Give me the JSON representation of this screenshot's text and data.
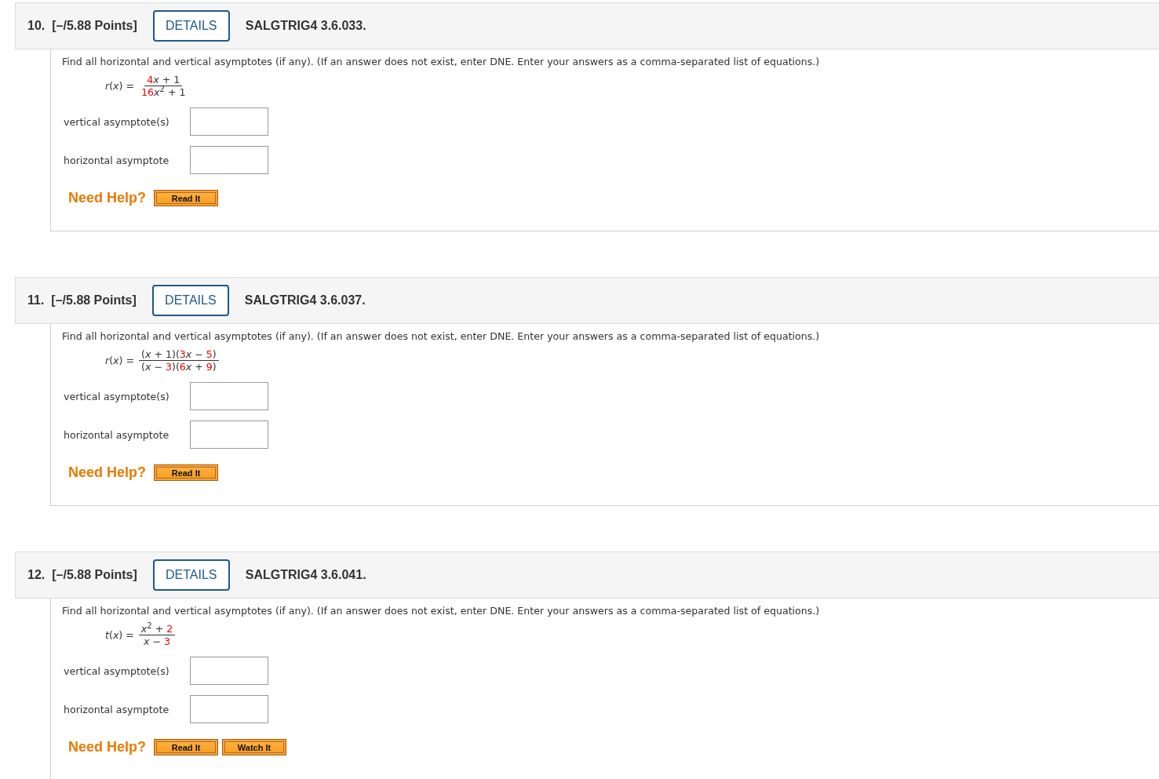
{
  "questions": [
    {
      "number": "10.",
      "points": "[–/5.88 Points]",
      "details_label": "DETAILS",
      "code": "SALGTRIG4 3.6.033.",
      "prompt": "Find all horizontal and vertical asymptotes (if any). (If an answer does not exist, enter DNE. Enter your answers as a comma-separated list of equations.)",
      "function_name": "*r*(*x*) =",
      "numerator": [
        {
          "text": "4",
          "highlighted": true
        },
        {
          "text": "*x* + 1",
          "highlighted": false
        }
      ],
      "denominator": [
        {
          "text": "16",
          "highlighted": true
        },
        {
          "text": "*x*$^{2}$ + 1",
          "highlighted": false
        }
      ],
      "fields": [
        {
          "label": "vertical asymptote(s)"
        },
        {
          "label": "horizontal asymptote"
        }
      ],
      "help_label": "Need Help?",
      "help_buttons": [
        "Read It"
      ]
    },
    {
      "number": "11.",
      "points": "[–/5.88 Points]",
      "details_label": "DETAILS",
      "code": "SALGTRIG4 3.6.037.",
      "prompt": "Find all horizontal and vertical asymptotes (if any). (If an answer does not exist, enter DNE. Enter your answers as a comma-separated list of equations.)",
      "function_name": "*r*(*x*) =",
      "numerator": [
        {
          "text": "(*x* + 1)(",
          "highlighted": false
        },
        {
          "text": "3",
          "highlighted": true
        },
        {
          "text": "*x* − ",
          "highlighted": false
        },
        {
          "text": "5",
          "highlighted": true
        },
        {
          "text": ")",
          "highlighted": false
        }
      ],
      "denominator": [
        {
          "text": "(*x* − ",
          "highlighted": false
        },
        {
          "text": "3",
          "highlighted": true
        },
        {
          "text": ")(",
          "highlighted": false
        },
        {
          "text": "6",
          "highlighted": true
        },
        {
          "text": "*x* + ",
          "highlighted": false
        },
        {
          "text": "9",
          "highlighted": true
        },
        {
          "text": ")",
          "highlighted": false
        }
      ],
      "fields": [
        {
          "label": "vertical asymptote(s)"
        },
        {
          "label": "horizontal asymptote"
        }
      ],
      "help_label": "Need Help?",
      "help_buttons": [
        "Read It"
      ]
    },
    {
      "number": "12.",
      "points": "[–/5.88 Points]",
      "details_label": "DETAILS",
      "code": "SALGTRIG4 3.6.041.",
      "prompt": "Find all horizontal and vertical asymptotes (if any). (If an answer does not exist, enter DNE. Enter your answers as a comma-separated list of equations.)",
      "function_name": "*t*(*x*) =",
      "numerator": [
        {
          "text": "*x*$^{2}$ + ",
          "highlighted": false
        },
        {
          "text": "2",
          "highlighted": true
        }
      ],
      "denominator": [
        {
          "text": "*x* − ",
          "highlighted": false
        },
        {
          "text": "3",
          "highlighted": true
        }
      ],
      "fields": [
        {
          "label": "vertical asymptote(s)"
        },
        {
          "label": "horizontal asymptote"
        }
      ],
      "help_label": "Need Help?",
      "help_buttons": [
        "Read It",
        "Watch It"
      ]
    }
  ]
}
